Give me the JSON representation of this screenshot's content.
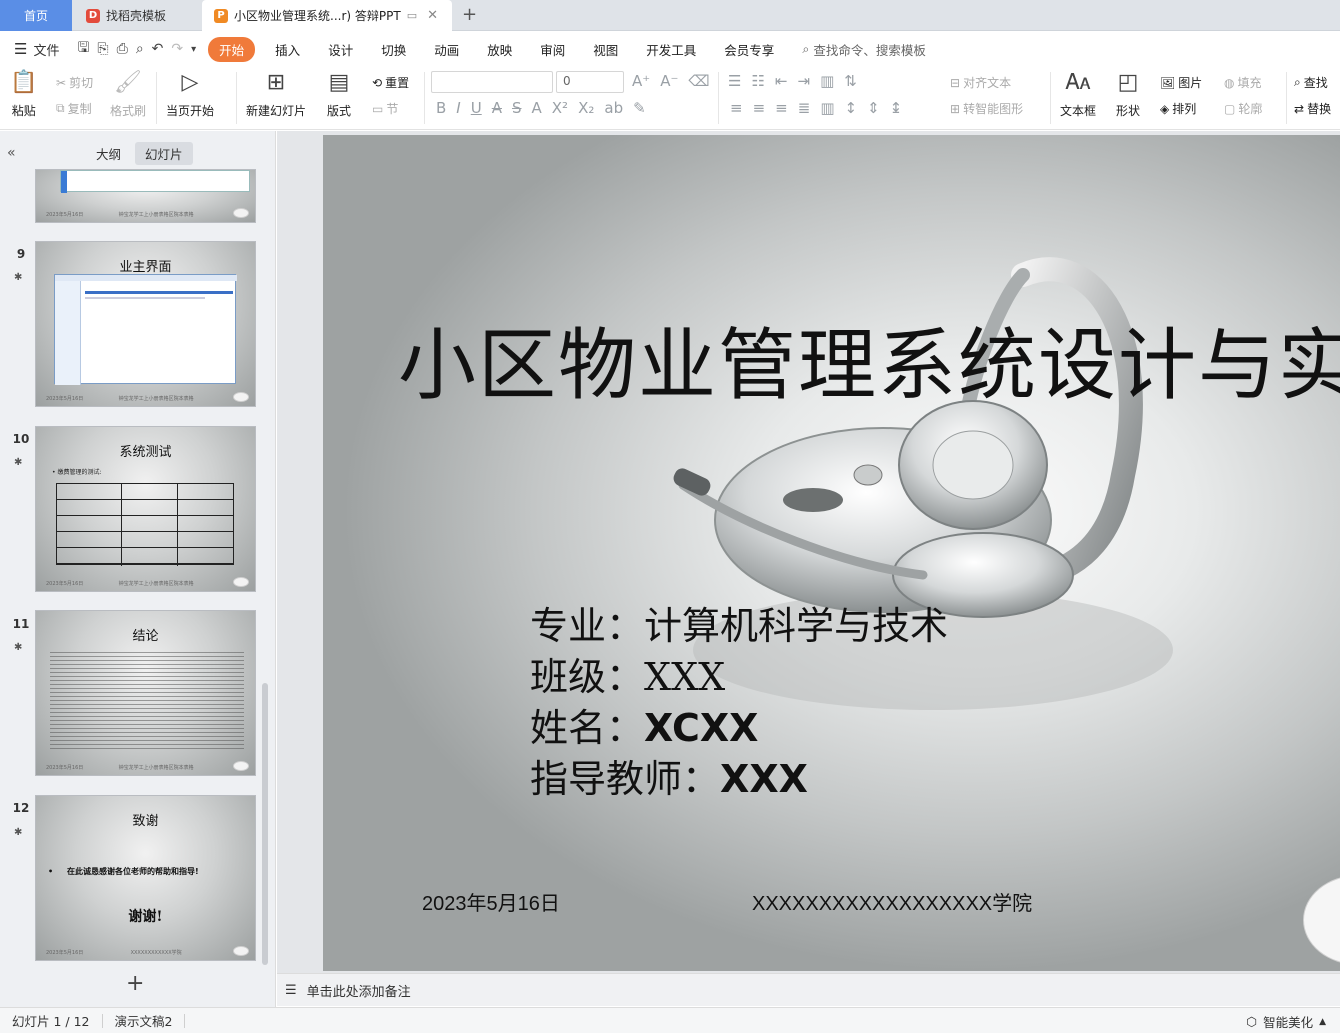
{
  "tabs": {
    "home": "首页",
    "template": "找稻壳模板",
    "doc_title": "小区物业管理系统...r)  答辩PPT"
  },
  "menu": {
    "file": "文件",
    "items": [
      "开始",
      "插入",
      "设计",
      "切换",
      "动画",
      "放映",
      "审阅",
      "视图",
      "开发工具",
      "会员专享"
    ],
    "search": "查找命令、搜索模板"
  },
  "ribbon": {
    "paste": "粘贴",
    "cut": "剪切",
    "copy": "复制",
    "format_painter": "格式刷",
    "from_current": "当页开始",
    "new_slide": "新建幻灯片",
    "layout": "版式",
    "reset": "重置",
    "section": "节",
    "font_size": "0",
    "align_text": "对齐文本",
    "smart_art": "转智能图形",
    "textbox": "文本框",
    "shape": "形状",
    "picture": "图片",
    "arrange": "排列",
    "fill": "填充",
    "outline": "轮廓",
    "find": "查找",
    "replace": "替换"
  },
  "left_panel": {
    "tab_outline": "大纲",
    "tab_slides": "幻灯片",
    "thumbs": [
      {
        "num": "",
        "title": "",
        "foot_left": "2023年5月16日",
        "foot_right": "钟宝龙学工上小册表格区院本表格"
      },
      {
        "num": "9",
        "title": "业主界面",
        "foot_left": "2023年5月16日",
        "foot_right": "钟宝龙学工上小册表格区院本表格"
      },
      {
        "num": "10",
        "title": "系统测试",
        "foot_left": "2023年5月16日",
        "foot_right": "钟宝龙学工上小册表格区院本表格"
      },
      {
        "num": "11",
        "title": "结论",
        "foot_left": "2023年5月16日",
        "foot_right": "钟宝龙学工上小册表格区院本表格"
      },
      {
        "num": "12",
        "title": "致谢",
        "foot_left": "2023年5月16日",
        "foot_right": "XXXXXXXXXXXX学院"
      }
    ],
    "thumb10_bullet": "缴费管理的测试:",
    "thumb12_line": "在此诚恳感谢各位老师的帮助和指导!",
    "thumb12_thanks": "谢谢!"
  },
  "slide": {
    "title": "小区物业管理系统设计与实",
    "major_label": "专业：",
    "major": "计算机科学与技术",
    "class_label": "班级：",
    "class": "XXX",
    "name_label": "姓名：",
    "name": "XCXX",
    "advisor_label": "指导教师：",
    "advisor": "XXX",
    "date": "2023年5月16日",
    "college": "XXXXXXXXXXXXXXXXXX学院"
  },
  "notes": {
    "placeholder": "单击此处添加备注"
  },
  "status": {
    "slide_count": "幻灯片 1 / 12",
    "theme": "演示文稿2",
    "smart_beautify": "智能美化"
  },
  "colors": {
    "accent": "#f07a3a",
    "home_tab": "#5a8ee6"
  }
}
